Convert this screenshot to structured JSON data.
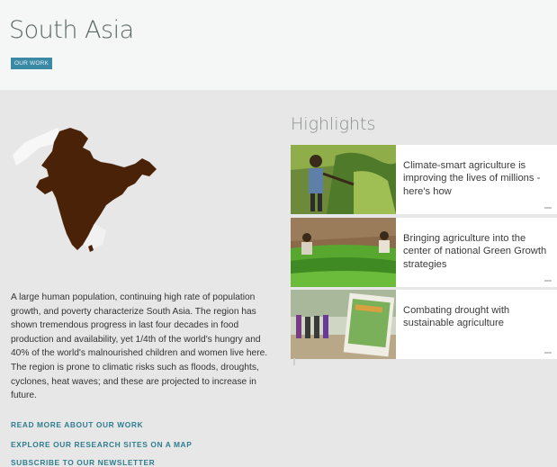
{
  "header": {
    "title": "South Asia",
    "tag_label": "OUR WORK"
  },
  "region": {
    "map_icon": "india-map",
    "map_color": "#4a2208",
    "description": "A large human population, continuing high rate of population growth, and poverty characterize South Asia. The region has shown tremendous progress in last four decades in food production and availability, yet 1/4th of the world's hungry and 40% of the world's malnourished children and women live here. The region is prone to climatic risks such as floods, droughts, cyclones, heat waves; and these are projected to increase in future."
  },
  "links": [
    {
      "label": "READ MORE ABOUT OUR WORK"
    },
    {
      "label": "EXPLORE OUR RESEARCH SITES ON A MAP"
    },
    {
      "label": "SUBSCRIBE TO OUR NEWSLETTER"
    }
  ],
  "highlights": {
    "title": "Highlights",
    "items": [
      {
        "text": "Climate-smart agriculture is improving the lives of millions - here's how"
      },
      {
        "text": "Bringing agriculture into the center of national Green Growth strategies"
      },
      {
        "text": "Combating drought with sustainable agriculture"
      }
    ]
  },
  "colors": {
    "accent": "#3b8aa5",
    "link": "#2f7d8f",
    "title": "#5b6a62"
  }
}
